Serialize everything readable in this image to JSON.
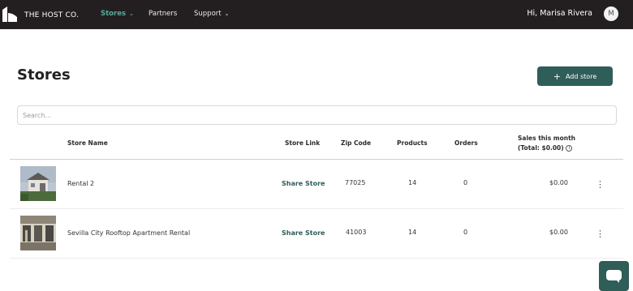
{
  "nav": {
    "brand": "THE HOST CO.",
    "items": [
      {
        "label": "Stores",
        "caret": "⌄"
      },
      {
        "label": "Partners"
      },
      {
        "label": "Support",
        "caret": "⌄"
      }
    ],
    "greeting": "Hi, Marisa Rivera",
    "avatar_initial": "M",
    "active_color": "#5aa99c"
  },
  "page": {
    "title": "Stores",
    "add_button": "Add store",
    "add_icon": "+",
    "search_placeholder": "Search..."
  },
  "table": {
    "headers": {
      "store_name": "Store Name",
      "store_link": "Store Link",
      "zip_code": "Zip Code",
      "products": "Products",
      "orders": "Orders",
      "sales_line1": "Sales this month",
      "sales_line2": "(Total: $0.00)"
    },
    "info_icon": "i",
    "rows": [
      {
        "name": "Rental 2",
        "link": "Share Store",
        "zip": "77025",
        "products": "14",
        "orders": "0",
        "sales": "$0.00",
        "menu": "⋮"
      },
      {
        "name": "Sevilla City Rooftop Apartment Rental",
        "link": "Share Store",
        "zip": "41003",
        "products": "14",
        "orders": "0",
        "sales": "$0.00",
        "menu": "⋮"
      }
    ]
  },
  "colors": {
    "topbar": "#231f20",
    "primary": "#2f5d58"
  }
}
